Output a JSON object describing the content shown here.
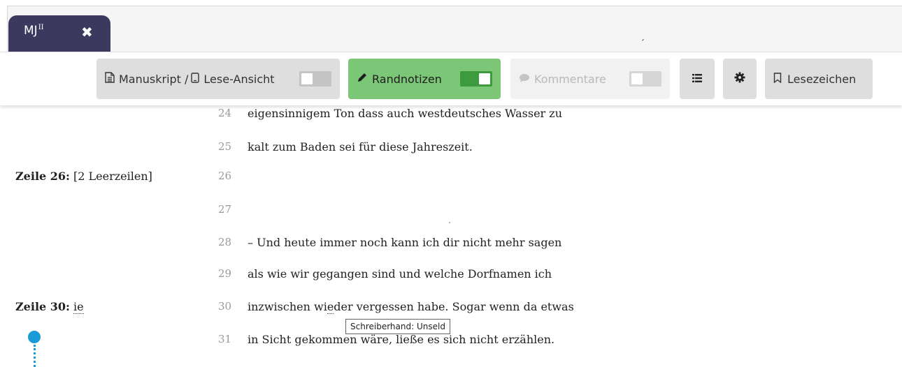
{
  "tab": {
    "label": "MJ",
    "sup": "II",
    "close_icon": "close-icon"
  },
  "toolbar": {
    "manuscript": {
      "icon": "document-icon",
      "label": "Manuskript /",
      "icon2": "tablet-icon",
      "label2": "Lese-Ansicht",
      "toggle": "off"
    },
    "margin_notes": {
      "icon": "pencil-icon",
      "label": "Randnotizen",
      "toggle": "on"
    },
    "comments": {
      "icon": "comment-icon",
      "label": "Kommentare",
      "toggle": "off",
      "disabled": true
    },
    "toc": {
      "icon": "list-icon"
    },
    "settings": {
      "icon": "gear-icon"
    },
    "bookmarks": {
      "icon": "bookmark-icon",
      "label": "Lesezeichen"
    }
  },
  "lines": [
    {
      "num": "24",
      "text": "eigensinnigem Ton dass auch westdeutsches Wasser zu"
    },
    {
      "num": "25",
      "text": "kalt zum Baden sei für diese Jahreszeit."
    },
    {
      "num": "26",
      "text": ""
    },
    {
      "num": "27",
      "text": ""
    },
    {
      "num": "28",
      "text": "– Und heute immer noch kann ich dir nicht mehr sagen"
    },
    {
      "num": "29",
      "text": "als wie wir gegangen sind und welche Dorfnamen ich"
    },
    {
      "num": "30",
      "text_before": "inzwischen wi",
      "text_mark": "e",
      "text_after": "der vergessen habe. Sogar wenn da etwas"
    },
    {
      "num": "31",
      "text": "in Sicht gekommen wäre, ließe es sich nicht erzählen."
    }
  ],
  "notes": [
    {
      "label": "Zeile 26:",
      "text": "[2 Leerzeilen]"
    },
    {
      "label": "Zeile 30:",
      "text": "ie"
    }
  ],
  "tooltip": "Schreiberhand: Unseld",
  "colors": {
    "tab_bg": "#3b3a5e",
    "active_button": "#7cc677",
    "toggle_on": "#3d9a3d",
    "marker": "#1a9ad6"
  }
}
